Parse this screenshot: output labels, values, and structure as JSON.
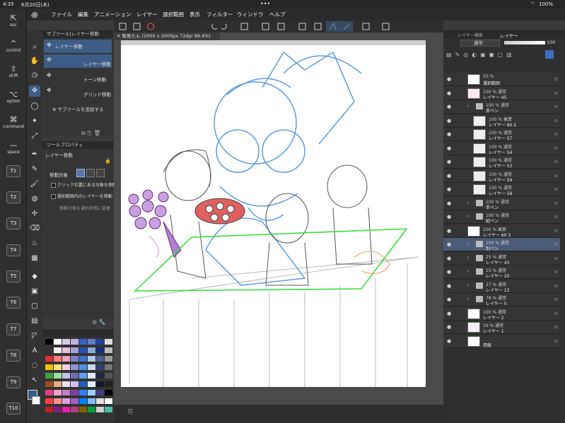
{
  "status_bar": {
    "time": "4:35",
    "date": "6月20日(木)",
    "battery": "100%"
  },
  "menu": [
    "ファイル",
    "編集",
    "アニメーション",
    "レイヤー",
    "選択範囲",
    "表示",
    "フィルター",
    "ウィンドウ",
    "ヘルプ"
  ],
  "left_bar": {
    "keys": [
      {
        "icon": "⇱",
        "label": "esc"
      },
      {
        "icon": "^",
        "label": "control"
      },
      {
        "icon": "⇧",
        "label": "shift"
      },
      {
        "icon": "⌥",
        "label": "option"
      },
      {
        "icon": "⌘",
        "label": "command"
      },
      {
        "icon": "—",
        "label": "space"
      }
    ],
    "t_buttons": [
      "T1",
      "T2",
      "T3",
      "T4",
      "T5",
      "T6",
      "T7",
      "T8",
      "T9",
      "T10"
    ]
  },
  "subtool": {
    "title": "サブツール[レイヤー移動",
    "items": [
      "レイヤー移動",
      "レイヤー移動",
      "トーン移動",
      "グリッド移動"
    ],
    "add_label": "サブツールを追加する"
  },
  "tool_property": {
    "title": "ツールプロパティ",
    "tool_name": "レイヤー移動",
    "target_label": "移動対象",
    "options": [
      "クリック位置にある対象を移動",
      "選択範囲内のレイヤーを移動",
      "移動対象を選択状態に変更"
    ]
  },
  "document": {
    "tab": "歌島たん (2000 x 2000px 72dpi 99.4%)"
  },
  "layers_panel": {
    "tabs": [
      "レイヤー検索",
      "レイヤー"
    ],
    "blend_mode": "通常",
    "opacity": "100",
    "layers": [
      {
        "l1": "50 %",
        "l2": "選択範囲",
        "type": "layer"
      },
      {
        "l1": "100 % 通常",
        "l2": "レイヤー 45",
        "type": "layer"
      },
      {
        "l1": "100 % 通常",
        "l2": "赤ペン",
        "type": "folder"
      },
      {
        "l1": "100 % 乗算",
        "l2": "レイヤー 60 2",
        "type": "layer"
      },
      {
        "l1": "100 % 通常",
        "l2": "レイヤー 57",
        "type": "layer"
      },
      {
        "l1": "100 % 通常",
        "l2": "レイヤー 54",
        "type": "layer"
      },
      {
        "l1": "100 % 通常",
        "l2": "レイヤー 53",
        "type": "layer"
      },
      {
        "l1": "100 % 通常",
        "l2": "レイヤー 59",
        "type": "layer"
      },
      {
        "l1": "100 % 通常",
        "l2": "レイヤー 58",
        "type": "layer"
      },
      {
        "l1": "100 % 通常",
        "l2": "手ペン",
        "type": "folder"
      },
      {
        "l1": "100 % 通常",
        "l2": "紀ペン",
        "type": "folder"
      },
      {
        "l1": "100 % 乗算",
        "l2": "レイヤー 60 3",
        "type": "layer"
      },
      {
        "l1": "100 % 通常",
        "l2": "別ペン",
        "type": "folder"
      },
      {
        "l1": "25 % 通常",
        "l2": "レイヤー 43",
        "type": "folder"
      },
      {
        "l1": "15 % 通常",
        "l2": "レイヤー 20",
        "type": "folder"
      },
      {
        "l1": "27 % 通常",
        "l2": "レイヤー 13",
        "type": "folder"
      },
      {
        "l1": "78 % 通常",
        "l2": "レイヤー 5",
        "type": "folder"
      },
      {
        "l1": "100 % 通常",
        "l2": "レイヤー 2",
        "type": "layer"
      },
      {
        "l1": "39 % 通常",
        "l2": "レイヤー 1",
        "type": "layer"
      },
      {
        "l1": "",
        "l2": "用紙",
        "type": "layer"
      }
    ]
  },
  "colors": {
    "accent": "#3d5d86",
    "selection": "#4b5c78",
    "green_plane": "#33dd33",
    "blue_sketch": "#5b9ee0"
  }
}
